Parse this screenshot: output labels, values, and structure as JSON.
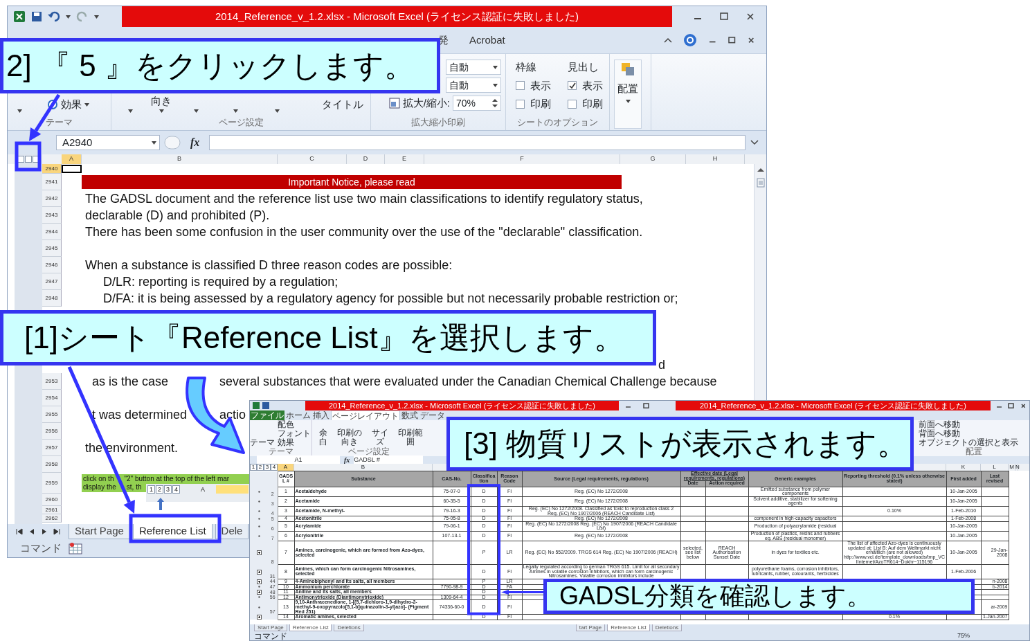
{
  "main_window": {
    "title": "2014_Reference_v_1.2.xlsx - Microsoft Excel (ライセンス認証に失敗しました)",
    "ribbon_tabs": [
      {
        "label": "発"
      },
      {
        "label": "Acrobat"
      }
    ],
    "theme_group": {
      "label": "テーマ",
      "effects": "効果"
    },
    "page_setup_group": {
      "label": "ページ設定",
      "orientation": "向き",
      "titles": "タイトル"
    },
    "scale_group": {
      "label": "拡大縮小印刷",
      "width": "自動",
      "height": "自動",
      "scale_label": "拡大/縮小:",
      "scale": "70%"
    },
    "sheet_options_group": {
      "label": "シートのオプション",
      "options": [
        {
          "title": "枠線",
          "view": {
            "label": "表示",
            "checked": false
          },
          "print": {
            "label": "印刷",
            "checked": false
          }
        },
        {
          "title": "見出し",
          "view": {
            "label": "表示",
            "checked": true
          },
          "print": {
            "label": "印刷",
            "checked": false
          }
        }
      ]
    },
    "arrange_button": "配置",
    "name_box": "A2940",
    "function_button": "fx",
    "column_headers": [
      "A",
      "B",
      "C",
      "D",
      "E",
      "F",
      "G",
      "H"
    ],
    "rows": [
      {
        "number": "2940",
        "selected": true,
        "kind": "blank"
      },
      {
        "number": "2941",
        "selected": false,
        "kind": "notice",
        "text": "Important Notice, please read"
      },
      {
        "number": "2942",
        "selected": false,
        "kind": "text",
        "text": "The GADSL document and the reference list use two main classifications to identify regulatory status,"
      },
      {
        "number": "2943",
        "selected": false,
        "kind": "text",
        "text": "declarable (D) and prohibited (P)."
      },
      {
        "number": "2944",
        "selected": false,
        "kind": "text",
        "text": "There has been some confusion in the user community over the use of the \"declarable\" classification."
      },
      {
        "number": "2945",
        "selected": false,
        "kind": "blank"
      },
      {
        "number": "2946",
        "selected": false,
        "kind": "text",
        "text": "When a substance is classified D three reason codes are possible:"
      },
      {
        "number": "2947",
        "selected": false,
        "kind": "indent",
        "text": "D/LR: reporting is required by a regulation;"
      },
      {
        "number": "2948",
        "selected": false,
        "kind": "indent",
        "text": "D/FA: it is being assessed by a regulatory agency for possible but not necessarily probable restriction or;"
      },
      {
        "kind": "blank"
      },
      {
        "kind": "blank"
      },
      {
        "kind": "blank"
      },
      {
        "kind": "tail",
        "text": "d"
      },
      {
        "number": "2953",
        "selected": false,
        "kind": "split",
        "texts": [
          "as is the case",
          "several substances that were evaluated under the Canadian Chemical Challenge because"
        ]
      },
      {
        "number": "2954",
        "selected": false,
        "kind": "blank"
      },
      {
        "number": "2955",
        "selected": false,
        "kind": "split",
        "texts": [
          "t was determined",
          "actio"
        ]
      },
      {
        "number": "2956",
        "selected": false,
        "kind": "blank"
      },
      {
        "number": "2957",
        "selected": false,
        "kind": "text",
        "text": "the environment."
      },
      {
        "number": "2958",
        "selected": false,
        "kind": "blank"
      },
      {
        "number": "2959",
        "selected": false,
        "kind": "note",
        "lines": [
          [
            "click on th",
            "\"2\" button at the top of the left mar"
          ],
          [
            "display the",
            "st, th"
          ]
        ],
        "levels": [
          "1",
          "2",
          "3",
          "4"
        ],
        "column": "A"
      },
      {
        "number": "2960",
        "selected": false,
        "kind": "blank"
      },
      {
        "number": "2961",
        "selected": false,
        "kind": "blank"
      },
      {
        "number": "2962",
        "selected": false,
        "kind": "blank"
      }
    ],
    "sheet_tabs": [
      {
        "label": "Start Page",
        "selected": false
      },
      {
        "label": "Reference List",
        "selected": true
      },
      {
        "label": "Dele",
        "selected": false
      }
    ],
    "status_mode": "コマンド"
  },
  "inset_window": {
    "titles": [
      "2014_Reference_v_1.2.xlsx - Microsoft Excel (ライセンス認証に失敗しました)",
      "2014_Reference_v_1.2.xlsx - Microsoft Excel (ライセンス認証に失敗しました)"
    ],
    "ribbon_tabs": [
      {
        "label": "ファイル",
        "kind": "file",
        "selected": false
      },
      {
        "label": "ホーム",
        "kind": "tab",
        "selected": false
      },
      {
        "label": "挿入",
        "kind": "tab",
        "selected": false
      },
      {
        "label": "ページレイアウト",
        "kind": "tab",
        "selected": true
      },
      {
        "label": "数式",
        "kind": "tab",
        "selected": false
      },
      {
        "label": "データ",
        "kind": "tab",
        "selected": false
      }
    ],
    "theme_button": "テーマ",
    "theme_items": [
      "配色",
      "フォント",
      "効果"
    ],
    "theme_group": "テーマ",
    "page_setup_items": [
      "余白",
      "印刷の向き",
      "サイズ",
      "印刷範囲"
    ],
    "page_setup_group": "ページ設定",
    "arrange_items": [
      "前面へ移動",
      "背面へ移動",
      "オブジェクトの選択と表示"
    ],
    "arrange_group": "配置",
    "name_box": "A1",
    "function_button": "fx",
    "formula": "GADSL #",
    "outline_levels": [
      "1",
      "2",
      "3",
      "4"
    ],
    "column_letters_left": [
      "A",
      "B"
    ],
    "column_letters_right": [
      "K",
      "L",
      "M",
      "N"
    ],
    "table": {
      "header": [
        {
          "label": "GADSL #"
        },
        {
          "label": "Substance"
        },
        {
          "label": "CAS-No."
        },
        {
          "label": "Classification"
        },
        {
          "label": "Reason Code"
        },
        {
          "label": "Source (Legal requirements, regulations)"
        },
        {
          "group": "Effective date (Legal requirements, regulations)",
          "labels": [
            "Date",
            "Action required"
          ]
        },
        {
          "label": "Generic examples"
        },
        {
          "label": "Reporting threshold (0.1% unless otherwise stated)"
        },
        {
          "label": "First added"
        },
        {
          "label": "Last revised"
        }
      ],
      "rows": [
        {
          "row": "2",
          "collapsed": false,
          "cells": [
            "1",
            "Acetaldehyde",
            "75-07-0",
            "D",
            "FI",
            "Reg. (EC) No 1272/2008",
            null,
            null,
            "Emitted substance from polymer components",
            null,
            "10-Jan-2005",
            null
          ]
        },
        {
          "row": "3",
          "collapsed": false,
          "cells": [
            "2",
            "Acetamide",
            "60-35-5",
            "D",
            "FI",
            "Reg. (EC) No 1272/2008",
            null,
            null,
            "Solvent additive, stabilizer for softening agents",
            null,
            "10-Jan-2005",
            null
          ]
        },
        {
          "row": "4",
          "collapsed": false,
          "cells": [
            "3",
            "Acetamide, N-methyl-",
            "79-16-3",
            "D",
            "FI",
            "Reg. (EC) No 1272/2008. Classified as toxic to reproduction class 2 Reg. (EC) No 1907/2006 (REACH Candidate List)",
            null,
            null,
            null,
            "0.10%",
            "1-Feb-2010",
            null
          ]
        },
        {
          "row": "5",
          "collapsed": false,
          "cells": [
            "4",
            "Acetonitrile",
            "75-05-8",
            "D",
            "FI",
            "Reg. (EC) No 1272/2008",
            null,
            null,
            "component in high-capacity capacitors",
            null,
            "1-Feb-2008",
            null
          ]
        },
        {
          "row": "6",
          "collapsed": false,
          "cells": [
            "5",
            "Acrylamide",
            "79-06-1",
            "D",
            "FI",
            "Reg. (EC) No 1272/2008 Reg. (EC) No 1907/2006 (REACH Candidate List)",
            null,
            null,
            "Production of polyacrylamide (residual",
            null,
            "10-Jan-2005",
            null
          ]
        },
        {
          "row": "7",
          "collapsed": false,
          "cells": [
            "6",
            "Acrylonitrile",
            "107-13-1",
            "D",
            "FI",
            "Reg. (EC) No 1272/2008",
            null,
            null,
            "Production of plastics, resins and rubbers eg. ABS (residual monomer)",
            null,
            "10-Jan-2005",
            null
          ]
        },
        {
          "row": "8",
          "collapsed": true,
          "cells": [
            "7",
            "Amines, carcinogenic, which are formed from Azo-dyes, selected",
            null,
            "P",
            "LR",
            "Reg. (EC) No 552/2009. TRGS 614 Reg. (EC) No 1907/2006 (REACH)",
            "selected, see list below",
            "REACH Authorisation Sunset Date",
            "in dyes for textiles etc.",
            "The list of affected Azo-dyes is continuously updated at: List B: Auf dem Weltmarkt nicht erhältlich (are not allowed) http://www.vci.de/template_downloads/tmp_VCIInternet/AzoTR614~Dokhr~115196",
            "10-Jan-2005",
            "29-Jan-2008"
          ]
        },
        {
          "row": "31",
          "collapsed": true,
          "cells": [
            "8",
            "Amines, which can form carcinogenic Nitrosamines, selected",
            null,
            "D",
            "FI",
            "Legally regulated according to german TRGS 615. Limit for all secondary Amines in volatile corrosion inhibitors, which can form carcinogenic Nitrosamines. Volatile corrosion inhibitors include",
            null,
            null,
            "polyurethane foams, corrosion inhibitors, lubricants, rubber, colourants, herbicides",
            null,
            "1-Feb-2006",
            null
          ]
        },
        {
          "row": "44",
          "collapsed": true,
          "cells": [
            "9",
            "4-Aminobiphenyl and its salts, all members",
            null,
            "P",
            "LR",
            null,
            null,
            null,
            null,
            null,
            null,
            "n-2008"
          ]
        },
        {
          "row": "47",
          "collapsed": false,
          "cells": [
            "10",
            "Ammonium perchlorate",
            "7790-98-9",
            "D",
            "FA",
            null,
            null,
            null,
            null,
            null,
            null,
            "b-2014"
          ]
        },
        {
          "row": "48",
          "collapsed": true,
          "cells": [
            "11",
            "Aniline and its salts, all members",
            null,
            "D",
            null,
            null,
            null,
            null,
            null,
            null,
            null,
            null
          ]
        },
        {
          "row": "56",
          "collapsed": false,
          "cells": [
            "12",
            "Antimonytrioxide (Diantimonytrioxide)",
            "1309-64-4",
            "D",
            "FI",
            null,
            null,
            null,
            null,
            null,
            null,
            null
          ]
        },
        {
          "row": "57",
          "collapsed": false,
          "cells": [
            "13",
            "9,10-Anthracenedione, 1-[(5,7-dichloro-1,9-dihydro-2-methyl-9-oxopyrazolo[5,1-b]quinazolin-3-yl)azo]- (Pigment Red 251)",
            "74336-60-0",
            "D",
            "FI",
            null,
            null,
            null,
            null,
            null,
            null,
            "ar-2009"
          ]
        },
        {
          "collapsed": true,
          "cells": [
            "14",
            "Aromatic amines, selected",
            null,
            "D",
            "FI",
            null,
            null,
            null,
            null,
            "0.1%",
            null,
            "1-Jan-2007"
          ]
        }
      ]
    },
    "sheet_tabs": [
      {
        "label": "Start Page",
        "selected": false
      },
      {
        "label": "Reference List",
        "selected": true
      },
      {
        "label": "Deletions",
        "selected": false
      },
      {
        "label": "tart Page",
        "selected": false
      },
      {
        "label": "Reference List",
        "selected": true
      },
      {
        "label": "Deletions",
        "selected": false
      }
    ],
    "status_mode": "コマンド",
    "zoom": "75%"
  },
  "callouts": [
    {
      "text": "2] 『 5 』をクリックします。"
    },
    {
      "text": "[1]シート『Reference List』を選択します。"
    },
    {
      "text": "[3]  物質リストが表示されます。"
    },
    {
      "text": "GADSL分類を確認します。"
    }
  ]
}
